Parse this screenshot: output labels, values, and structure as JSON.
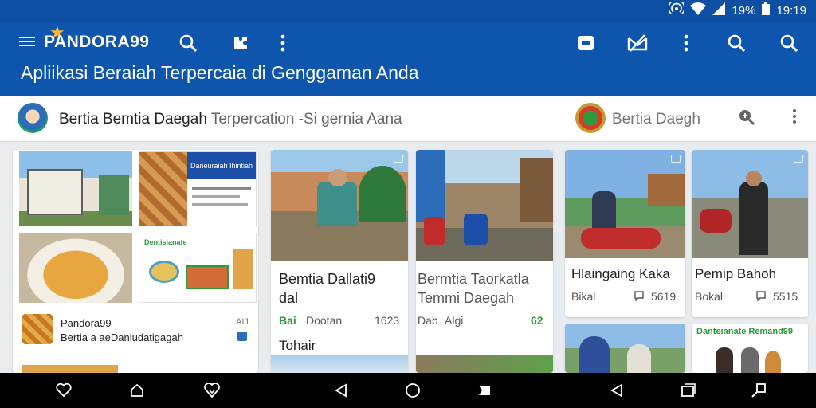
{
  "status": {
    "battery": "19%",
    "time": "19:19"
  },
  "header": {
    "brand": "PANDORA99",
    "tagline": "Apliikasi Beraiah Terpercaia di Genggaman Anda"
  },
  "subbar": {
    "title": "Bertia Bemtia Daegah",
    "subtitle": "Terpercation -Si gernia Aana",
    "right_title": "Bertia Daegh"
  },
  "cards": {
    "collage": {
      "poster_title": "Daneuraiah Ihintiah",
      "poster2_title": "Dentisianate",
      "brand": "Pandora99",
      "desc": "Bertia a aeDaniudatigagah",
      "tag": "AIJ"
    },
    "c1": {
      "title_line1": "Bemtia Dallati9",
      "title_line2": "dal",
      "meta_left": "Bai",
      "meta_mid": "Dootan",
      "meta_right": "1623",
      "extra": "Tohair"
    },
    "c2": {
      "title_line1": "Bermtia Taorkatla",
      "title_line2": "Temmi Daegah",
      "meta_left": "Dab",
      "meta_mid": "Algi",
      "meta_right": "62"
    },
    "c3": {
      "title": "Hlaingaing Kaka",
      "meta_left": "Bikal",
      "meta_right": "5619"
    },
    "c4": {
      "title": "Pemip Bahoh",
      "meta_left": "Bokal",
      "meta_right": "5515"
    },
    "c6": {
      "label": "Danteianate Remand99"
    }
  },
  "colors": {
    "header": "#0d55ad",
    "status": "#0d4fa3",
    "accent_green": "#2e9a3c"
  }
}
